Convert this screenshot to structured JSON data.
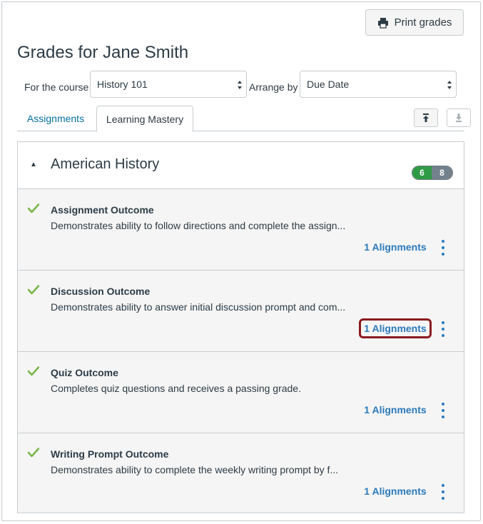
{
  "toolbar": {
    "print_label": "Print grades"
  },
  "page": {
    "title": "Grades for Jane Smith"
  },
  "filters": {
    "course_label": "For the course",
    "course_value": "History 101",
    "arrange_label": "Arrange by",
    "arrange_value": "Due Date"
  },
  "tabs": [
    {
      "label": "Assignments",
      "active": false
    },
    {
      "label": "Learning Mastery",
      "active": true
    }
  ],
  "group": {
    "title": "American History",
    "mastered_count": "6",
    "total_count": "8",
    "colors": {
      "mastered": "#2f9b46",
      "total": "#73818c"
    }
  },
  "outcomes": [
    {
      "title": "Assignment Outcome",
      "description": "Demonstrates ability to follow directions and complete the assign...",
      "alignments": "1 Alignments",
      "highlighted": false
    },
    {
      "title": "Discussion Outcome",
      "description": "Demonstrates ability to answer initial discussion prompt and com...",
      "alignments": "1 Alignments",
      "highlighted": true
    },
    {
      "title": "Quiz Outcome",
      "description": "Completes quiz questions and receives a passing grade.",
      "alignments": "1 Alignments",
      "highlighted": false
    },
    {
      "title": "Writing Prompt Outcome",
      "description": "Demonstrates ability to complete the weekly writing prompt by f...",
      "alignments": "1 Alignments",
      "highlighted": false
    }
  ],
  "icons": {
    "print": "printer-icon",
    "expand": "expand-all-icon",
    "collapse": "collapse-all-icon",
    "caret": "caret-up-icon",
    "check": "checkmark-icon",
    "menu": "kebab-menu-icon"
  },
  "colors": {
    "link": "#2b7abc",
    "check": "#7ab648",
    "highlight": "#8b1a1f"
  }
}
